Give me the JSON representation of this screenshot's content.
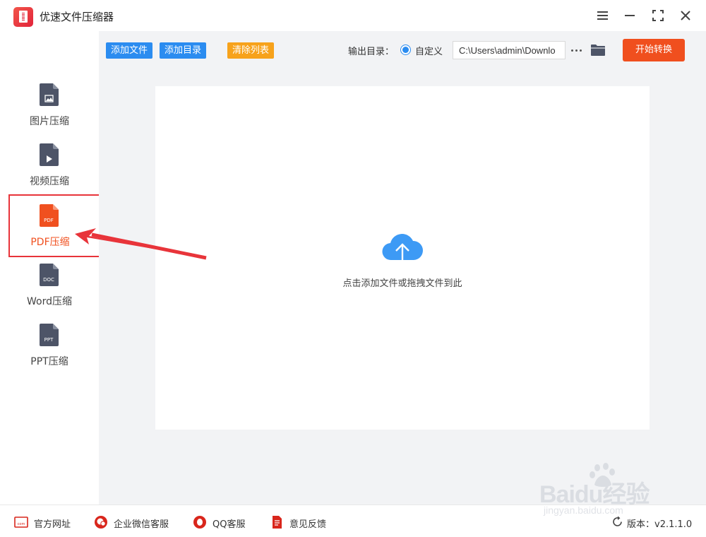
{
  "window": {
    "title": "优速文件压缩器"
  },
  "sidebar": {
    "items": [
      {
        "label": "图片压缩",
        "badge": "",
        "color": "#4d5467"
      },
      {
        "label": "视频压缩",
        "badge": "",
        "color": "#4d5467"
      },
      {
        "label": "PDF压缩",
        "badge": "PDF",
        "color": "#f0501f",
        "active": true
      },
      {
        "label": "Word压缩",
        "badge": "DOC",
        "color": "#4d5467"
      },
      {
        "label": "PPT压缩",
        "badge": "PPT",
        "color": "#4d5467"
      }
    ]
  },
  "toolbar": {
    "add_file": "添加文件",
    "add_folder": "添加目录",
    "clear_list": "清除列表",
    "output_label": "输出目录：",
    "custom_option": "自定义",
    "output_path": "C:\\Users\\admin\\Downlo",
    "start": "开始转换"
  },
  "dropzone": {
    "hint": "点击添加文件或拖拽文件到此"
  },
  "footer": {
    "website": "官方网址",
    "wechat": "企业微信客服",
    "qq": "QQ客服",
    "feedback": "意见反馈",
    "version": "版本：v2.1.1.0"
  },
  "watermark": {
    "brand": "Baidu经验",
    "url": "jingyan.baidu.com"
  },
  "colors": {
    "accent_blue": "#2b8cf0",
    "accent_orange": "#f7a21b",
    "start_red": "#f04f1e",
    "highlight_red": "#e8343a"
  }
}
